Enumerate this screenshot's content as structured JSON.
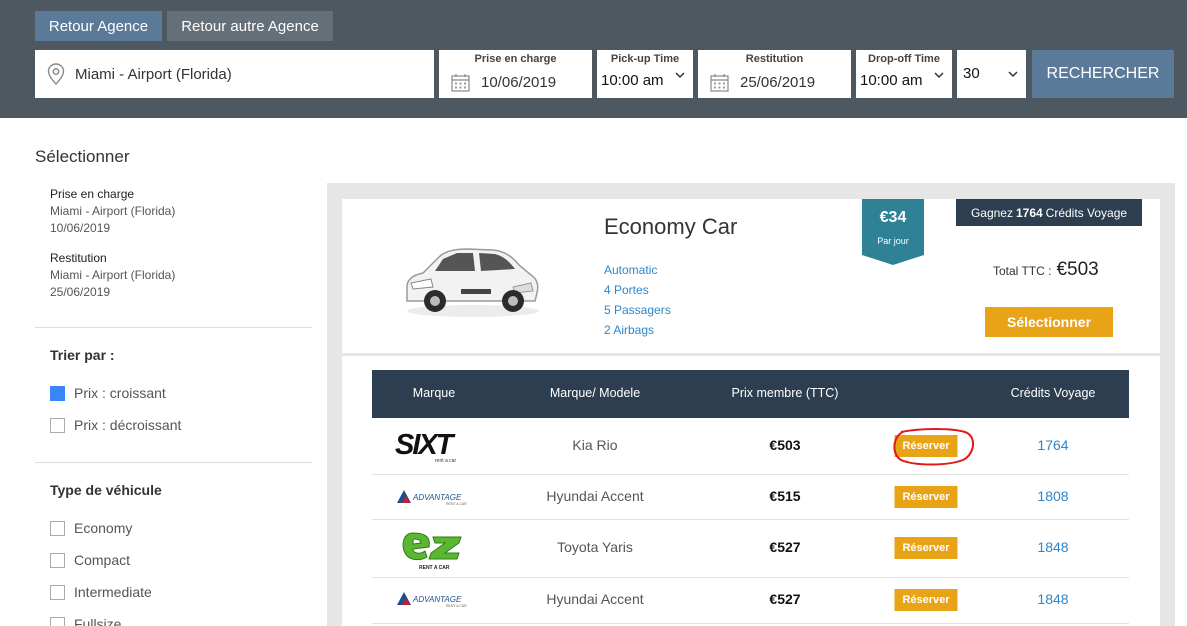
{
  "tabs": [
    {
      "label": "Retour Agence",
      "active": true
    },
    {
      "label": "Retour autre Agence",
      "active": false
    }
  ],
  "search": {
    "location": "Miami - Airport (Florida)",
    "pickup_label": "Prise en charge",
    "pickup_date": "10/06/2019",
    "pickup_time_label": "Pick-up Time",
    "pickup_time": "10:00 am",
    "return_label": "Restitution",
    "return_date": "25/06/2019",
    "dropoff_time_label": "Drop-off Time",
    "dropoff_time": "10:00 am",
    "age": "30",
    "button": "RECHERCHER"
  },
  "sidebar": {
    "title": "Sélectionner",
    "pickup_heading": "Prise en charge",
    "pickup_place": "Miami - Airport (Florida)",
    "pickup_date": "10/06/2019",
    "return_heading": "Restitution",
    "return_place": "Miami - Airport (Florida)",
    "return_date": "25/06/2019",
    "sort_title": "Trier par :",
    "sort_options": [
      {
        "label": "Prix : croissant",
        "checked": true
      },
      {
        "label": "Prix : décroissant",
        "checked": false
      }
    ],
    "type_title": "Type de véhicule",
    "type_options": [
      {
        "label": "Economy",
        "checked": false
      },
      {
        "label": "Compact",
        "checked": false
      },
      {
        "label": "Intermediate",
        "checked": false
      },
      {
        "label": "Fullsize",
        "checked": false
      }
    ]
  },
  "card": {
    "name": "Economy Car",
    "features": [
      "Automatic",
      "4 Portes",
      "5 Passagers",
      "2 Airbags"
    ],
    "per_day_price": "€34",
    "per_day_label": "Par jour",
    "earn_prefix": "Gagnez",
    "earn_amount": "1764",
    "earn_suffix": "Crédits Voyage",
    "total_label": "Total TTC :",
    "total_value": "€503",
    "select_button": "Sélectionner"
  },
  "table": {
    "headers": [
      "Marque",
      "Marque/ Modele",
      "Prix membre (TTC)",
      "Crédits Voyage"
    ],
    "reserve_label": "Réserver",
    "rows": [
      {
        "brand": "sixt-logo",
        "model": "Kia Rio",
        "price": "€503",
        "credits": "1764"
      },
      {
        "brand": "advantage-logo",
        "model": "Hyundai Accent",
        "price": "€515",
        "credits": "1808"
      },
      {
        "brand": "ez-logo",
        "model": "Toyota Yaris",
        "price": "€527",
        "credits": "1848"
      },
      {
        "brand": "advantage-logo",
        "model": "Hyundai Accent",
        "price": "€527",
        "credits": "1848"
      }
    ]
  },
  "colors": {
    "header_bg": "#4d5861",
    "accent_blue": "#5b7a99",
    "dark_navy": "#2c3e50",
    "teal_ribbon": "#2f8296",
    "orange": "#e8a317",
    "link_blue": "#2e86c9"
  }
}
